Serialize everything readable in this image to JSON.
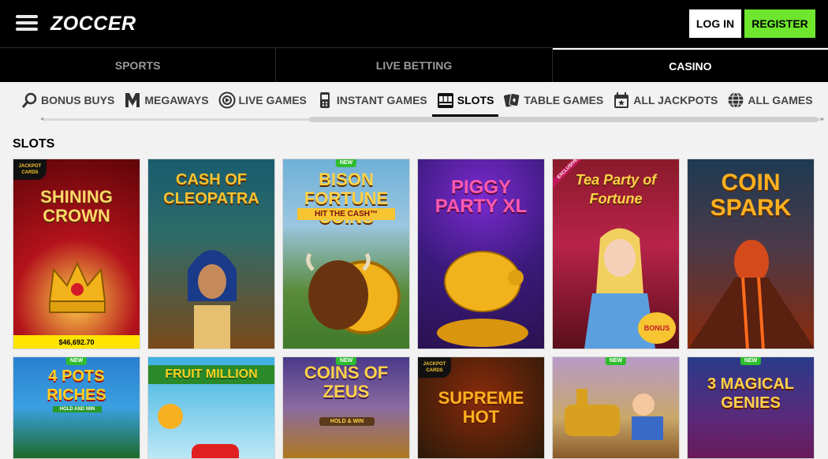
{
  "header": {
    "logo": "ZOCCER",
    "login_label": "LOG IN",
    "register_label": "REGISTER"
  },
  "main_tabs": [
    {
      "label": "SPORTS",
      "active": false
    },
    {
      "label": "LIVE BETTING",
      "active": false
    },
    {
      "label": "CASINO",
      "active": true
    }
  ],
  "categories": [
    {
      "label": "BONUS BUYS",
      "icon": "magnifier-icon"
    },
    {
      "label": "MEGAWAYS",
      "icon": "megaways-icon"
    },
    {
      "label": "LIVE GAMES",
      "icon": "live-games-icon"
    },
    {
      "label": "INSTANT GAMES",
      "icon": "instant-games-icon"
    },
    {
      "label": "SLOTS",
      "icon": "slot-machine-icon",
      "active": true
    },
    {
      "label": "TABLE GAMES",
      "icon": "cards-icon"
    },
    {
      "label": "ALL JACKPOTS",
      "icon": "calendar-icon"
    },
    {
      "label": "ALL GAMES",
      "icon": "globe-icon"
    }
  ],
  "section_title": "SLOTS",
  "tiles_row1": [
    {
      "title": "SHINING CROWN",
      "jackpot_label": "JACKPOT CARDS",
      "jackpot_value": "$46,692.70",
      "colors": [
        "#b3121b",
        "#5e0509"
      ]
    },
    {
      "title": "CASH OF CLEOPATRA",
      "colors": [
        "#1a5c6e",
        "#7a4a1a"
      ]
    },
    {
      "title": "BISON FORTUNE COINS",
      "subtitle": "HIT THE CASH™",
      "badge": "NEW",
      "colors": [
        "#6fb0d8",
        "#3f7a2a"
      ]
    },
    {
      "title": "PIGGY PARTY XL",
      "colors": [
        "#3a1a7a",
        "#c98a10"
      ]
    },
    {
      "title": "Tea Party of Fortune",
      "badge": "EXCLUSIVE",
      "bonus_label": "BONUS",
      "colors": [
        "#5a0e1a",
        "#b8234a"
      ]
    },
    {
      "title": "COIN SPARK",
      "colors": [
        "#1e3a52",
        "#8a2a0a"
      ]
    }
  ],
  "tiles_row2": [
    {
      "title": "4 POTS RICHES",
      "subtitle": "HOLD AND WIN",
      "badge": "NEW",
      "colors": [
        "#2a7fd0",
        "#1d6a2a"
      ]
    },
    {
      "title": "FRUIT MILLION",
      "colors": [
        "#3ab0e0",
        "#bce8f5"
      ]
    },
    {
      "title": "COINS OF ZEUS",
      "subtitle": "HOLD & WIN",
      "badge": "NEW",
      "colors": [
        "#4a3a8a",
        "#b07a20"
      ]
    },
    {
      "title": "SUPREME HOT",
      "jackpot_label": "JACKPOT CARDS",
      "colors": [
        "#2a1a0a",
        "#6a1a0a"
      ]
    },
    {
      "title": "",
      "badge": "NEW",
      "colors": [
        "#b89ac8",
        "#8a5a2a"
      ]
    },
    {
      "title": "3 MAGICAL GENIES",
      "badge": "NEW",
      "colors": [
        "#2a3a8a",
        "#6a1a5a"
      ]
    }
  ]
}
